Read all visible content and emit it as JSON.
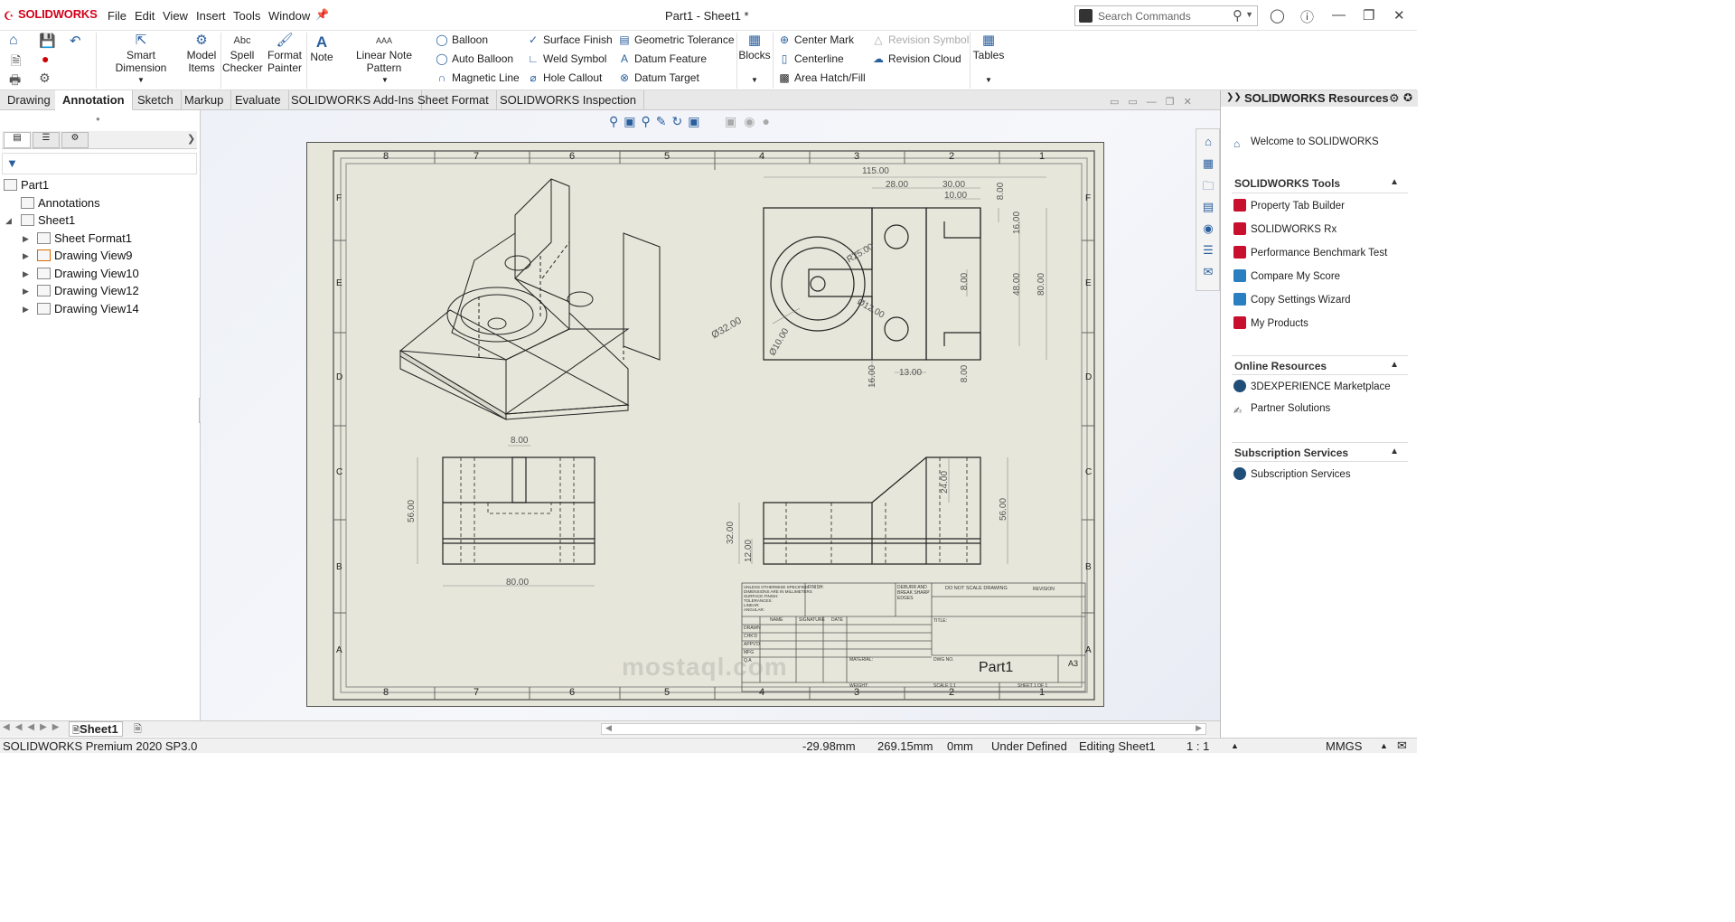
{
  "app": {
    "name": "SOLIDWORKS",
    "doc_title": "Part1 - Sheet1 *"
  },
  "menu": [
    "File",
    "Edit",
    "View",
    "Insert",
    "Tools",
    "Window"
  ],
  "search": {
    "placeholder": "Search Commands"
  },
  "ribbon": {
    "smart_dimension": "Smart Dimension",
    "model_items": [
      "Model",
      "Items"
    ],
    "spell_checker": [
      "Spell",
      "Checker"
    ],
    "format_painter": [
      "Format",
      "Painter"
    ],
    "note": "Note",
    "linear_note_pattern": "Linear Note Pattern",
    "balloon": "Balloon",
    "auto_balloon": "Auto Balloon",
    "magnetic_line": "Magnetic Line",
    "surface_finish": "Surface Finish",
    "weld_symbol": "Weld Symbol",
    "hole_callout": "Hole Callout",
    "geometric_tolerance": "Geometric Tolerance",
    "datum_feature": "Datum Feature",
    "datum_target": "Datum Target",
    "blocks": "Blocks",
    "center_mark": "Center Mark",
    "centerline": "Centerline",
    "area_hatch": "Area Hatch/Fill",
    "revision_symbol": "Revision Symbol",
    "revision_cloud": "Revision Cloud",
    "tables": "Tables"
  },
  "tabs": [
    "Drawing",
    "Annotation",
    "Sketch",
    "Markup",
    "Evaluate",
    "SOLIDWORKS Add-Ins",
    "Sheet Format",
    "SOLIDWORKS Inspection"
  ],
  "tree": {
    "root": "Part1",
    "items": [
      "Annotations",
      "Sheet1",
      "Sheet Format1",
      "Drawing View9",
      "Drawing View10",
      "Drawing View12",
      "Drawing View14"
    ]
  },
  "drawing": {
    "zone_cols": [
      "8",
      "7",
      "6",
      "5",
      "4",
      "3",
      "2",
      "1"
    ],
    "zone_rows": [
      "F",
      "E",
      "D",
      "C",
      "B",
      "A"
    ],
    "dims_top": [
      "115.00",
      "28.00",
      "30.00",
      "10.00",
      "8.00",
      "16.00",
      "48.00",
      "80.00",
      "8.00",
      "R25.00",
      "Ø12.00",
      "Ø32.00",
      "Ø10.00",
      "16.00",
      "13.00",
      "8.00"
    ],
    "dims_front": [
      "8.00",
      "56.00",
      "80.00"
    ],
    "dims_side": [
      "24.00",
      "56.00",
      "32.00",
      "12.00"
    ],
    "title_block": {
      "part_name": "Part1",
      "size": "A3",
      "do_not_scale": "DO NOT SCALE DRAWING",
      "revision": "REVISION",
      "title": "TITLE:",
      "dwg_no": "DWG NO.",
      "unless": [
        "UNLESS OTHERWISE SPECIFIED:",
        "DIMENSIONS ARE IN MILLIMETERS",
        "SURFACE FINISH:",
        "TOLERANCES:",
        "LINEAR:",
        "ANGULAR:"
      ],
      "finish": "FINISH:",
      "deburr": [
        "DEBURR AND",
        "BREAK SHARP",
        "EDGES"
      ],
      "cols": [
        "NAME",
        "SIGNATURE",
        "DATE"
      ],
      "rows": [
        "DRAWN",
        "CHK'D",
        "APPV'D",
        "MFG",
        "Q.A"
      ],
      "material": "MATERIAL:",
      "weight": "WEIGHT:",
      "scale": "SCALE:1:1",
      "sheet": "SHEET 1 OF 1"
    }
  },
  "taskpane": {
    "title": "SOLIDWORKS Resources",
    "welcome": "Welcome to SOLIDWORKS",
    "sections": [
      {
        "title": "SOLIDWORKS Tools",
        "items": [
          "Property Tab Builder",
          "SOLIDWORKS Rx",
          "Performance Benchmark Test",
          "Compare My Score",
          "Copy Settings Wizard",
          "My Products"
        ]
      },
      {
        "title": "Online Resources",
        "items": [
          "3DEXPERIENCE Marketplace",
          "Partner Solutions"
        ]
      },
      {
        "title": "Subscription Services",
        "items": [
          "Subscription Services"
        ]
      }
    ]
  },
  "sheet_tab": "Sheet1",
  "status": {
    "product": "SOLIDWORKS Premium 2020 SP3.0",
    "x": "-29.98mm",
    "y": "269.15mm",
    "z": "0mm",
    "state": "Under Defined",
    "editing": "Editing Sheet1",
    "scale": "1 : 1",
    "units": "MMGS"
  },
  "watermark": "mostaql.com",
  "colors": {
    "accent": "#2a5f9e",
    "brand": "#d4001a",
    "sheet": "#e7e6da"
  }
}
